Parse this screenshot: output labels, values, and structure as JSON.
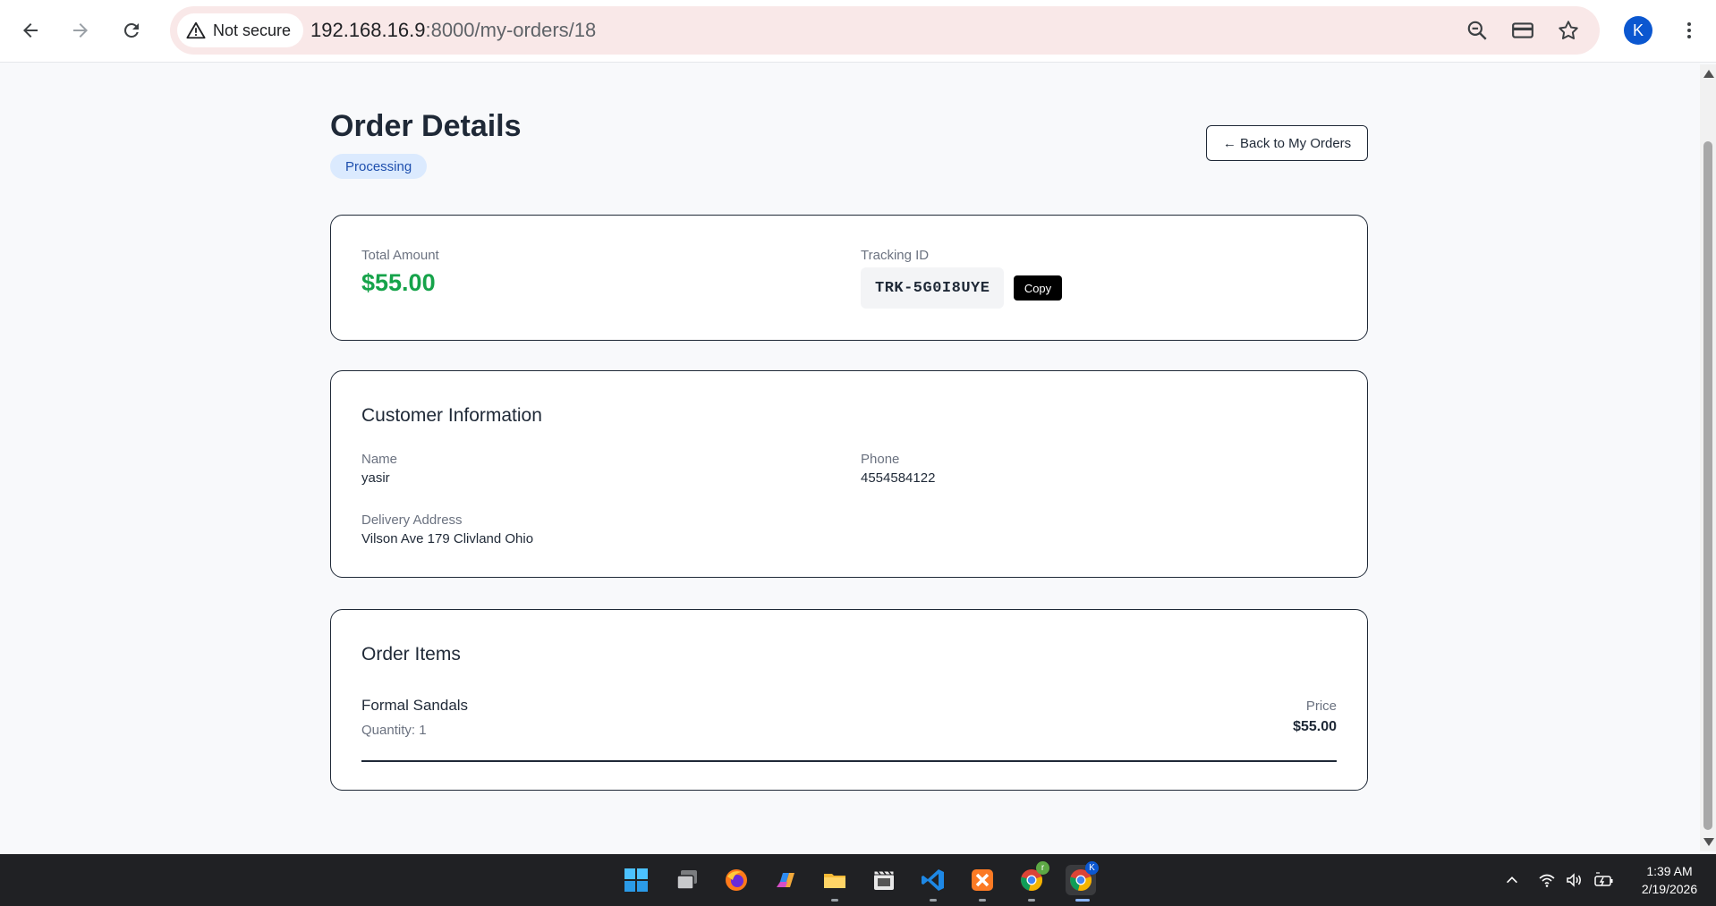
{
  "browser": {
    "security_label": "Not secure",
    "url_host": "192.168.16.9",
    "url_rest": ":8000/my-orders/18",
    "profile_initial": "K"
  },
  "page": {
    "title": "Order Details",
    "status": "Processing",
    "back_label": "← Back to My Orders"
  },
  "summary": {
    "total_label": "Total Amount",
    "total_value": "$55.00",
    "tracking_label": "Tracking ID",
    "tracking_value": "TRK-5G0I8UYE",
    "copy_label": "Copy"
  },
  "customer": {
    "section_title": "Customer Information",
    "name_label": "Name",
    "name_value": "yasir",
    "phone_label": "Phone",
    "phone_value": "4554584122",
    "address_label": "Delivery Address",
    "address_value": "Vilson Ave 179 Clivland Ohio"
  },
  "items": {
    "section_title": "Order Items",
    "list": [
      {
        "name": "Formal Sandals",
        "quantity": "Quantity: 1",
        "price_label": "Price",
        "price": "$55.00"
      }
    ]
  },
  "taskbar": {
    "apps": [
      "windows-start",
      "task-view",
      "firefox",
      "copilot",
      "file-explorer",
      "video-editor",
      "vscode",
      "xampp",
      "chrome-profile-2",
      "chrome-profile-k"
    ],
    "chrome_badge_1": "r",
    "chrome_badge_2": "K",
    "time": "1:39 AM",
    "date": "2/19/2026"
  },
  "colors": {
    "accent_green": "#16a34a",
    "status_bg": "#dbeafe",
    "status_text": "#1e4fae",
    "omnibox_bg": "#f9e8e8",
    "profile_blue": "#0b57d0"
  }
}
